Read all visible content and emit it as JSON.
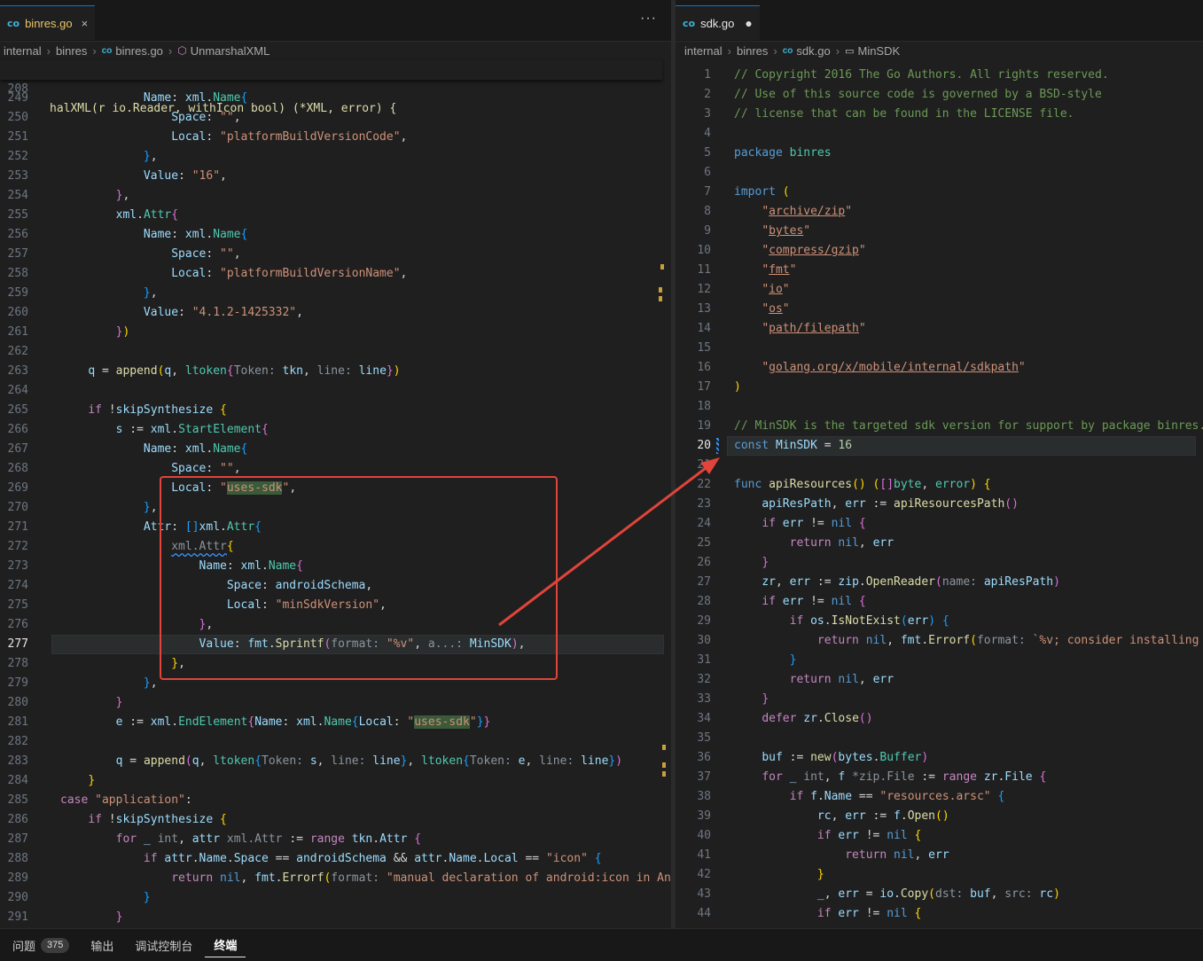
{
  "left": {
    "tab": {
      "icon": "co",
      "label": "binres.go",
      "close": "×"
    },
    "more": "···",
    "breadcrumb": {
      "items": [
        "internal",
        "binres",
        "binres.go",
        "UnmarshalXML"
      ]
    },
    "sticky": {
      "line": "208",
      "code": "halXML(r io.Reader, withIcon bool) (*XML, error) {"
    },
    "lines": [
      {
        "n": "249",
        "html": "            <span class='id'>Name</span>: <span class='id'>xml</span>.<span class='typ'>Name</span><span class='br3'>{</span>"
      },
      {
        "n": "250",
        "html": "                <span class='id'>Space</span>: <span class='str'>\"\"</span>,"
      },
      {
        "n": "251",
        "html": "                <span class='id'>Local</span>: <span class='str'>\"platformBuildVersionCode\"</span>,"
      },
      {
        "n": "252",
        "html": "            <span class='br3'>}</span>,"
      },
      {
        "n": "253",
        "html": "            <span class='id'>Value</span>: <span class='str'>\"16\"</span>,"
      },
      {
        "n": "254",
        "html": "        <span class='br2'>}</span>,"
      },
      {
        "n": "255",
        "html": "        <span class='id'>xml</span>.<span class='typ'>Attr</span><span class='br2'>{</span>"
      },
      {
        "n": "256",
        "html": "            <span class='id'>Name</span>: <span class='id'>xml</span>.<span class='typ'>Name</span><span class='br3'>{</span>"
      },
      {
        "n": "257",
        "html": "                <span class='id'>Space</span>: <span class='str'>\"\"</span>,"
      },
      {
        "n": "258",
        "html": "                <span class='id'>Local</span>: <span class='str'>\"platformBuildVersionName\"</span>,"
      },
      {
        "n": "259",
        "html": "            <span class='br3'>}</span>,"
      },
      {
        "n": "260",
        "html": "            <span class='id'>Value</span>: <span class='str'>\"4.1.2-1425332\"</span>,"
      },
      {
        "n": "261",
        "html": "        <span class='br2'>}</span><span class='br1'>)</span>"
      },
      {
        "n": "262",
        "html": ""
      },
      {
        "n": "263",
        "html": "    <span class='id'>q</span> = <span class='fn'>append</span><span class='br1'>(</span><span class='id'>q</span>, <span class='typ'>ltoken</span><span class='br2'>{</span><span class='hint'>Token:</span> <span class='id'>tkn</span>, <span class='hint'>line:</span> <span class='id'>line</span><span class='br2'>}</span><span class='br1'>)</span>"
      },
      {
        "n": "264",
        "html": ""
      },
      {
        "n": "265",
        "html": "    <span class='kw2'>if</span> !<span class='id'>skipSynthesize</span> <span class='br1'>{</span>"
      },
      {
        "n": "266",
        "html": "        <span class='id'>s</span> := <span class='id'>xml</span>.<span class='typ'>StartElement</span><span class='br2'>{</span>"
      },
      {
        "n": "267",
        "html": "            <span class='id'>Name</span>: <span class='id'>xml</span>.<span class='typ'>Name</span><span class='br3'>{</span>"
      },
      {
        "n": "268",
        "html": "                <span class='id'>Space</span>: <span class='str'>\"\"</span>,"
      },
      {
        "n": "269",
        "html": "                <span class='id'>Local</span>: <span class='str'>\"<span class='hl'>uses-sdk</span>\"</span>,"
      },
      {
        "n": "270",
        "html": "            <span class='br3'>}</span>,"
      },
      {
        "n": "271",
        "html": "            <span class='id'>Attr</span>: <span class='br3'>[]</span><span class='id'>xml</span>.<span class='typ'>Attr</span><span class='br3'>{</span>"
      },
      {
        "n": "272",
        "html": "                <span class='squiggle'><span class='hint'>xml.Attr</span></span><span class='br1'>{</span>"
      },
      {
        "n": "273",
        "html": "                    <span class='id'>Name</span>: <span class='id'>xml</span>.<span class='typ'>Name</span><span class='br2'>{</span>"
      },
      {
        "n": "274",
        "html": "                        <span class='id'>Space</span>: <span class='id'>androidSchema</span>,"
      },
      {
        "n": "275",
        "html": "                        <span class='id'>Local</span>: <span class='str'>\"minSdkVersion\"</span>,"
      },
      {
        "n": "276",
        "html": "                    <span class='br2'>}</span>,"
      },
      {
        "n": "277",
        "html": "                    <span class='id'>Value</span>: <span class='id'>fmt</span>.<span class='fn'>Sprintf</span><span class='br2'>(</span><span class='hint'>format:</span> <span class='str'>\"%v\"</span>, <span class='hint'>a...:</span> <span class='id'>MinSDK</span><span class='br2'>)</span>,"
      },
      {
        "n": "278",
        "html": "                <span class='br1'>}</span>,"
      },
      {
        "n": "279",
        "html": "            <span class='br3'>}</span>,"
      },
      {
        "n": "280",
        "html": "        <span class='br2'>}</span>"
      },
      {
        "n": "281",
        "html": "        <span class='id'>e</span> := <span class='id'>xml</span>.<span class='typ'>EndElement</span><span class='br2'>{</span><span class='id'>Name</span>: <span class='id'>xml</span>.<span class='typ'>Name</span><span class='br3'>{</span><span class='id'>Local</span>: <span class='str'>\"<span class='hl'>uses-sdk</span>\"</span><span class='br3'>}</span><span class='br2'>}</span>"
      },
      {
        "n": "282",
        "html": ""
      },
      {
        "n": "283",
        "html": "        <span class='id'>q</span> = <span class='fn'>append</span><span class='br2'>(</span><span class='id'>q</span>, <span class='typ'>ltoken</span><span class='br3'>{</span><span class='hint'>Token:</span> <span class='id'>s</span>, <span class='hint'>line:</span> <span class='id'>line</span><span class='br3'>}</span>, <span class='typ'>ltoken</span><span class='br3'>{</span><span class='hint'>Token:</span> <span class='id'>e</span>, <span class='hint'>line:</span> <span class='id'>line</span><span class='br3'>}</span><span class='br2'>)</span>"
      },
      {
        "n": "284",
        "html": "    <span class='br1'>}</span>"
      },
      {
        "n": "285",
        "html": "<span class='kw2'>case</span> <span class='str'>\"application\"</span>:"
      },
      {
        "n": "286",
        "html": "    <span class='kw2'>if</span> !<span class='id'>skipSynthesize</span> <span class='br1'>{</span>"
      },
      {
        "n": "287",
        "html": "        <span class='kw2'>for</span> <span class='id'>_</span> <span class='hint'>int</span>, <span class='id'>attr</span> <span class='hint'>xml.Attr</span> := <span class='kw2'>range</span> <span class='id'>tkn</span>.<span class='id'>Attr</span> <span class='br2'>{</span>"
      },
      {
        "n": "288",
        "html": "            <span class='kw2'>if</span> <span class='id'>attr</span>.<span class='id'>Name</span>.<span class='id'>Space</span> == <span class='id'>androidSchema</span> &amp;&amp; <span class='id'>attr</span>.<span class='id'>Name</span>.<span class='id'>Local</span> == <span class='str'>\"icon\"</span> <span class='br3'>{</span>"
      },
      {
        "n": "289",
        "html": "                <span class='kw2'>return</span> <span class='kw'>nil</span>, <span class='id'>fmt</span>.<span class='fn'>Errorf</span><span class='br1'>(</span><span class='hint'>format:</span> <span class='str'>\"manual declaration of android:icon in An</span>"
      },
      {
        "n": "290",
        "html": "            <span class='br3'>}</span>"
      },
      {
        "n": "291",
        "html": "        <span class='br2'>}</span>"
      }
    ]
  },
  "right": {
    "tab": {
      "icon": "co",
      "label": "sdk.go",
      "dirty": "●"
    },
    "breadcrumb": {
      "items": [
        "internal",
        "binres",
        "sdk.go",
        "MinSDK"
      ]
    },
    "lines": [
      {
        "n": "1",
        "html": "<span class='cm'>// Copyright 2016 The Go Authors. All rights reserved.</span>"
      },
      {
        "n": "2",
        "html": "<span class='cm'>// Use of this source code is governed by a BSD-style</span>"
      },
      {
        "n": "3",
        "html": "<span class='cm'>// license that can be found in the LICENSE file.</span>"
      },
      {
        "n": "4",
        "html": ""
      },
      {
        "n": "5",
        "html": "<span class='kw'>package</span> <span class='typ'>binres</span>"
      },
      {
        "n": "6",
        "html": ""
      },
      {
        "n": "7",
        "html": "<span class='kw'>import</span> <span class='br1'>(</span>"
      },
      {
        "n": "8",
        "html": "    <span class='str'>\"<span class='underline'>archive/zip</span>\"</span>"
      },
      {
        "n": "9",
        "html": "    <span class='str'>\"<span class='underline'>bytes</span>\"</span>"
      },
      {
        "n": "10",
        "html": "    <span class='str'>\"<span class='underline'>compress/gzip</span>\"</span>"
      },
      {
        "n": "11",
        "html": "    <span class='str'>\"<span class='underline'>fmt</span>\"</span>"
      },
      {
        "n": "12",
        "html": "    <span class='str'>\"<span class='underline'>io</span>\"</span>"
      },
      {
        "n": "13",
        "html": "    <span class='str'>\"<span class='underline'>os</span>\"</span>"
      },
      {
        "n": "14",
        "html": "    <span class='str'>\"<span class='underline'>path/filepath</span>\"</span>"
      },
      {
        "n": "15",
        "html": ""
      },
      {
        "n": "16",
        "html": "    <span class='str'>\"<span class='underline'>golang.org/x/mobile/internal/sdkpath</span>\"</span>"
      },
      {
        "n": "17",
        "html": "<span class='br1'>)</span>"
      },
      {
        "n": "18",
        "html": ""
      },
      {
        "n": "19",
        "html": "<span class='cm'>// MinSDK is the targeted sdk version for support by package binres.</span>"
      },
      {
        "n": "20",
        "html": "<span class='kw'>const</span> <span class='id'>MinSDK</span> = <span class='num'>16</span>"
      },
      {
        "n": "21",
        "html": ""
      },
      {
        "n": "22",
        "html": "<span class='kw'>func</span> <span class='fn'>apiResources</span><span class='br1'>()</span> <span class='br1'>(</span><span class='br2'>[]</span><span class='typ'>byte</span>, <span class='typ'>error</span><span class='br1'>)</span> <span class='br1'>{</span>"
      },
      {
        "n": "23",
        "html": "    <span class='id'>apiResPath</span>, <span class='id'>err</span> := <span class='fn'>apiResourcesPath</span><span class='br2'>()</span>"
      },
      {
        "n": "24",
        "html": "    <span class='kw2'>if</span> <span class='id'>err</span> != <span class='kw'>nil</span> <span class='br2'>{</span>"
      },
      {
        "n": "25",
        "html": "        <span class='kw2'>return</span> <span class='kw'>nil</span>, <span class='id'>err</span>"
      },
      {
        "n": "26",
        "html": "    <span class='br2'>}</span>"
      },
      {
        "n": "27",
        "html": "    <span class='id'>zr</span>, <span class='id'>err</span> := <span class='id'>zip</span>.<span class='fn'>OpenReader</span><span class='br2'>(</span><span class='hint'>name:</span> <span class='id'>apiResPath</span><span class='br2'>)</span>"
      },
      {
        "n": "28",
        "html": "    <span class='kw2'>if</span> <span class='id'>err</span> != <span class='kw'>nil</span> <span class='br2'>{</span>"
      },
      {
        "n": "29",
        "html": "        <span class='kw2'>if</span> <span class='id'>os</span>.<span class='fn'>IsNotExist</span><span class='br3'>(</span><span class='id'>err</span><span class='br3'>)</span> <span class='br3'>{</span>"
      },
      {
        "n": "30",
        "html": "            <span class='kw2'>return</span> <span class='kw'>nil</span>, <span class='id'>fmt</span>.<span class='fn'>Errorf</span><span class='br1'>(</span><span class='hint'>format:</span> <span class='str'>`%v; consider installing w</span>"
      },
      {
        "n": "31",
        "html": "        <span class='br3'>}</span>"
      },
      {
        "n": "32",
        "html": "        <span class='kw2'>return</span> <span class='kw'>nil</span>, <span class='id'>err</span>"
      },
      {
        "n": "33",
        "html": "    <span class='br2'>}</span>"
      },
      {
        "n": "34",
        "html": "    <span class='kw2'>defer</span> <span class='id'>zr</span>.<span class='fn'>Close</span><span class='br2'>()</span>"
      },
      {
        "n": "35",
        "html": ""
      },
      {
        "n": "36",
        "html": "    <span class='id'>buf</span> := <span class='fn'>new</span><span class='br2'>(</span><span class='id'>bytes</span>.<span class='typ'>Buffer</span><span class='br2'>)</span>"
      },
      {
        "n": "37",
        "html": "    <span class='kw2'>for</span> <span class='id'>_</span> <span class='hint'>int</span>, <span class='id'>f</span> <span class='hint'>*zip.File</span> := <span class='kw2'>range</span> <span class='id'>zr</span>.<span class='id'>File</span> <span class='br2'>{</span>"
      },
      {
        "n": "38",
        "html": "        <span class='kw2'>if</span> <span class='id'>f</span>.<span class='id'>Name</span> == <span class='str'>\"resources.arsc\"</span> <span class='br3'>{</span>"
      },
      {
        "n": "39",
        "html": "            <span class='id'>rc</span>, <span class='id'>err</span> := <span class='id'>f</span>.<span class='fn'>Open</span><span class='br1'>()</span>"
      },
      {
        "n": "40",
        "html": "            <span class='kw2'>if</span> <span class='id'>err</span> != <span class='kw'>nil</span> <span class='br1'>{</span>"
      },
      {
        "n": "41",
        "html": "                <span class='kw2'>return</span> <span class='kw'>nil</span>, <span class='id'>err</span>"
      },
      {
        "n": "42",
        "html": "            <span class='br1'>}</span>"
      },
      {
        "n": "43",
        "html": "            <span class='id'>_</span>, <span class='id'>err</span> = <span class='id'>io</span>.<span class='fn'>Copy</span><span class='br1'>(</span><span class='hint'>dst:</span> <span class='id'>buf</span>, <span class='hint'>src:</span> <span class='id'>rc</span><span class='br1'>)</span>"
      },
      {
        "n": "44",
        "html": "            <span class='kw2'>if</span> <span class='id'>err</span> != <span class='kw'>nil</span> <span class='br1'>{</span>"
      }
    ]
  },
  "bottom": {
    "problems_label": "问题",
    "problems_count": "375",
    "output_label": "输出",
    "debug_console_label": "调试控制台",
    "terminal_label": "终端"
  },
  "colors": {
    "annotation": "#e0443a",
    "accent": "#0078d4"
  }
}
